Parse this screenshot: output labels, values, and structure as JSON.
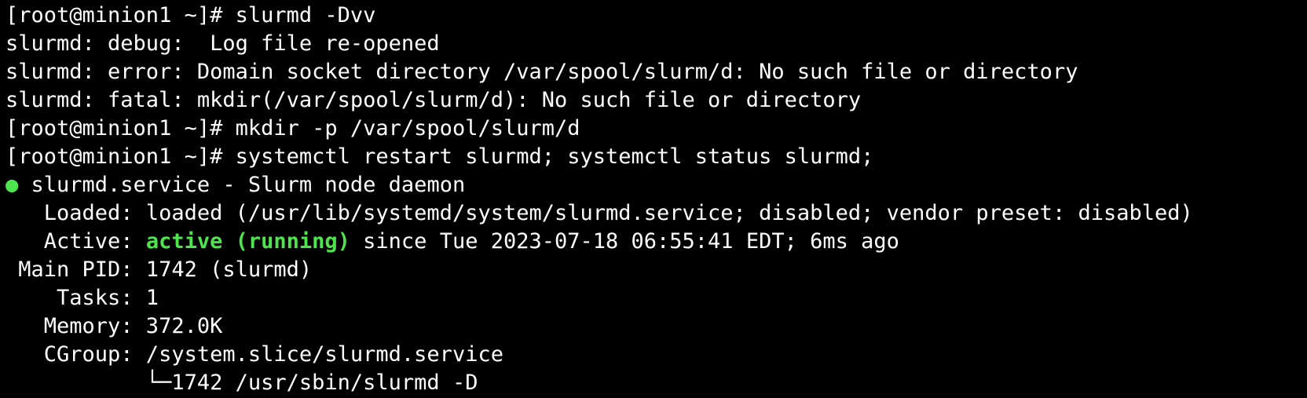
{
  "colors": {
    "background": "#000000",
    "text": "#ffffff",
    "active": "#4ee44e"
  },
  "lines": [
    "[root@minion1 ~]# slurmd -Dvv",
    "slurmd: debug:  Log file re-opened",
    "slurmd: error: Domain socket directory /var/spool/slurm/d: No such file or directory",
    "slurmd: fatal: mkdir(/var/spool/slurm/d): No such file or directory",
    "[root@minion1 ~]# mkdir -p /var/spool/slurm/d",
    "[root@minion1 ~]# systemctl restart slurmd; systemctl status slurmd;"
  ],
  "service": {
    "bullet": "●",
    "title": " slurmd.service - Slurm node daemon",
    "loaded": "   Loaded: loaded (/usr/lib/systemd/system/slurmd.service; disabled; vendor preset: disabled)",
    "active_label": "   Active: ",
    "active_state": "active (running)",
    "active_since": " since Tue 2023-07-18 06:55:41 EDT; 6ms ago",
    "main_pid": " Main PID: 1742 (slurmd)",
    "tasks": "    Tasks: 1",
    "memory": "   Memory: 372.0K",
    "cgroup": "   CGroup: /system.slice/slurmd.service",
    "cgroup_indent": "           ",
    "cgroup_tree": "└─",
    "cgroup_process": "1742 /usr/sbin/slurmd -D"
  }
}
